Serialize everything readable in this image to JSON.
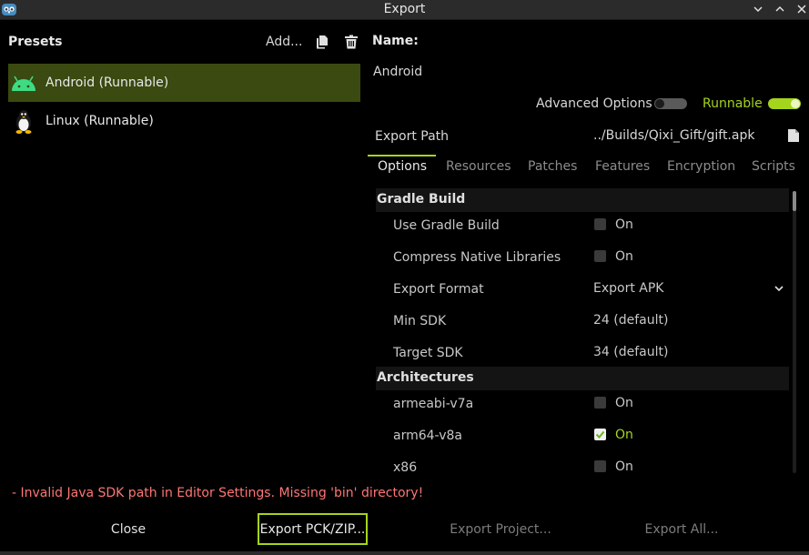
{
  "window": {
    "title": "Export",
    "icon": "godot-icon",
    "controls": [
      "minimize-icon",
      "maximize-icon",
      "close-icon"
    ]
  },
  "presets": {
    "title": "Presets",
    "add_label": "Add...",
    "duplicate_icon": "duplicate-icon",
    "delete_icon": "trash-icon",
    "items": [
      {
        "label": "Android (Runnable)",
        "icon": "android-icon",
        "selected": true
      },
      {
        "label": "Linux (Runnable)",
        "icon": "linux-icon",
        "selected": false
      }
    ]
  },
  "details": {
    "name_label": "Name:",
    "name_value": "Android",
    "advanced_label": "Advanced Options",
    "advanced_on": false,
    "runnable_label": "Runnable",
    "runnable_on": true,
    "export_path_label": "Export Path",
    "export_path_value": "../Builds/Qixi_Gift/gift.apk",
    "file_icon": "file-icon",
    "tabs": [
      "Options",
      "Resources",
      "Patches",
      "Features",
      "Encryption",
      "Scripts"
    ],
    "active_tab": "Options"
  },
  "options": {
    "gradle_section": "Gradle Build",
    "use_gradle_label": "Use Gradle Build",
    "use_gradle_value": "On",
    "compress_label": "Compress Native Libraries",
    "compress_value": "On",
    "export_format_label": "Export Format",
    "export_format_value": "Export APK",
    "min_sdk_label": "Min SDK",
    "min_sdk_value": "24 (default)",
    "target_sdk_label": "Target SDK",
    "target_sdk_value": "34 (default)",
    "arch_section": "Architectures",
    "armeabi_label": "armeabi-v7a",
    "armeabi_value": "On",
    "arm64_label": "arm64-v8a",
    "arm64_value": "On",
    "x86_label": "x86",
    "x86_value": "On"
  },
  "error_text": "- Invalid Java SDK path in Editor Settings. Missing 'bin' directory!",
  "buttons": {
    "close": "Close",
    "export_pck": "Export PCK/ZIP...",
    "export_project": "Export Project...",
    "export_all": "Export All..."
  },
  "colors": {
    "accent": "#a5d41c",
    "error": "#ff7575",
    "selection": "#3a4a10"
  }
}
